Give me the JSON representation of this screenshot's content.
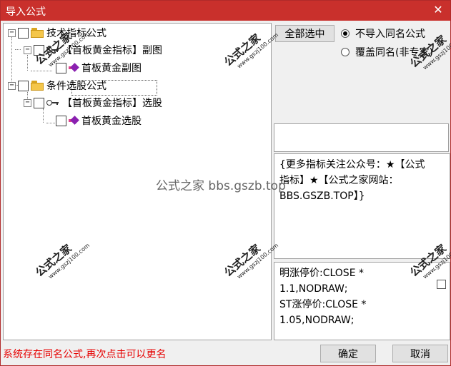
{
  "window": {
    "title": "导入公式",
    "close_glyph": "✕"
  },
  "tree": {
    "nodes": [
      {
        "label": "技术指标公式"
      },
      {
        "label": "【首板黄金指标】副图"
      },
      {
        "label": "首板黄金副图"
      },
      {
        "label": "条件选股公式"
      },
      {
        "label": "【首板黄金指标】选股"
      },
      {
        "label": "首板黄金选股"
      }
    ],
    "expander_glyph": "−"
  },
  "options": {
    "select_all_label": "全部选中",
    "no_import_label": "不导入同名公式",
    "overwrite_label": "覆盖同名(非专家)",
    "selected": "no_import"
  },
  "info_text": "{更多指标关注公众号：★【公式指标】★【公式之家网站：BBS.GSZB.TOP】}",
  "code_text": "明涨停价:CLOSE *\n1.1,NODRAW;\nST涨停价:CLOSE *\n1.05,NODRAW;",
  "status_message": "系统存在同名公式,再次点击可以更名",
  "buttons": {
    "ok_label": "确定",
    "cancel_label": "取消"
  },
  "watermark": {
    "title": "公式之家",
    "url": "www.gszj100.com",
    "center_text": "公式之家 bbs.gszb.top"
  },
  "colors": {
    "titlebar": "#c9302c",
    "status_text": "#e60000"
  }
}
